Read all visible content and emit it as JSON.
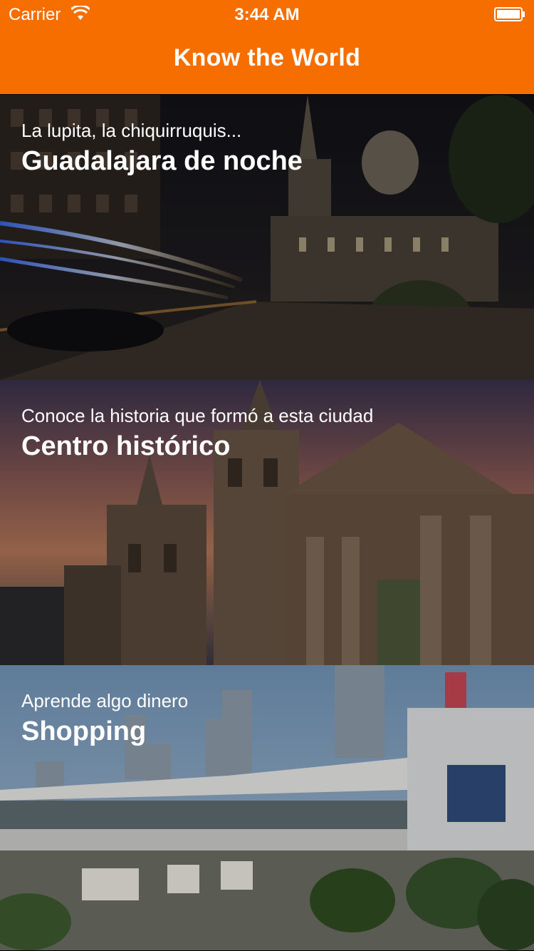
{
  "status_bar": {
    "carrier": "Carrier",
    "time": "3:44 AM"
  },
  "nav": {
    "title": "Know the World",
    "accent": "#F66D00"
  },
  "cards": [
    {
      "subtitle": "La lupita, la chiquirruquis...",
      "title": "Guadalajara de noche"
    },
    {
      "subtitle": "Conoce la historia que formó a esta ciudad",
      "title": "Centro histórico"
    },
    {
      "subtitle": "Aprende algo dinero",
      "title": "Shopping"
    }
  ]
}
